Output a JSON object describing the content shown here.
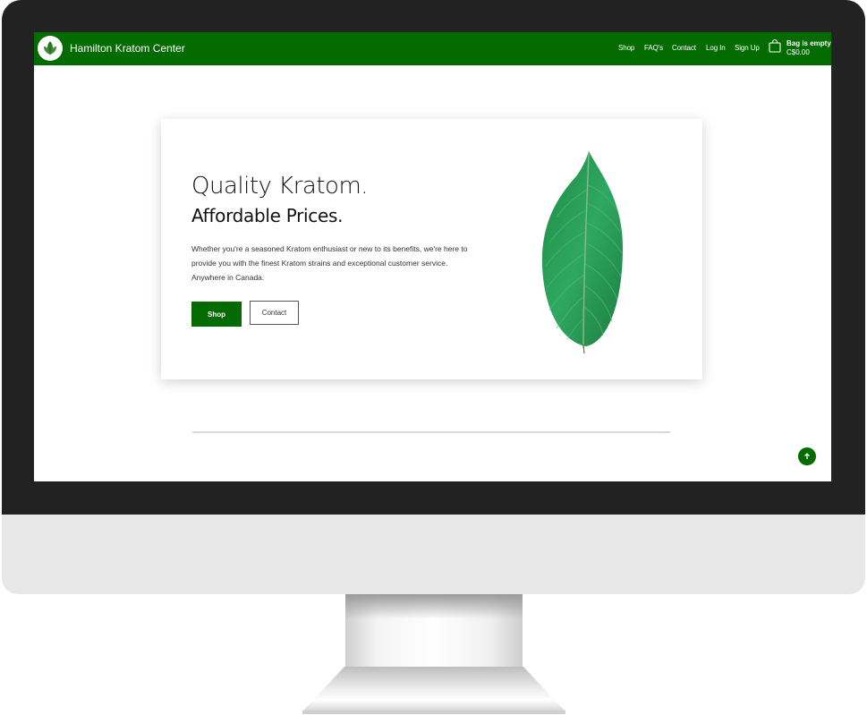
{
  "site": {
    "brand_name": "Hamilton Kratom Center",
    "accent_color": "#046b00",
    "logo_icon": "leaf-logo-icon"
  },
  "nav": {
    "links": [
      "Shop",
      "FAQ's",
      "Contact",
      "Log In",
      "Sign Up"
    ]
  },
  "cart": {
    "icon": "shopping-bag-icon",
    "status": "Bag is empty",
    "total": "C$0.00"
  },
  "hero": {
    "title": "Quality Kratom.",
    "subtitle": "Affordable Prices.",
    "description": "Whether you're a seasoned Kratom enthusiast or new to its benefits, we're here to provide you with the finest Kratom strains and exceptional customer service. Anywhere in Canada.",
    "shop_button": "Shop",
    "contact_button": "Contact",
    "image": "kratom-leaf-image"
  },
  "scroll_top": {
    "icon": "arrow-up-icon"
  }
}
